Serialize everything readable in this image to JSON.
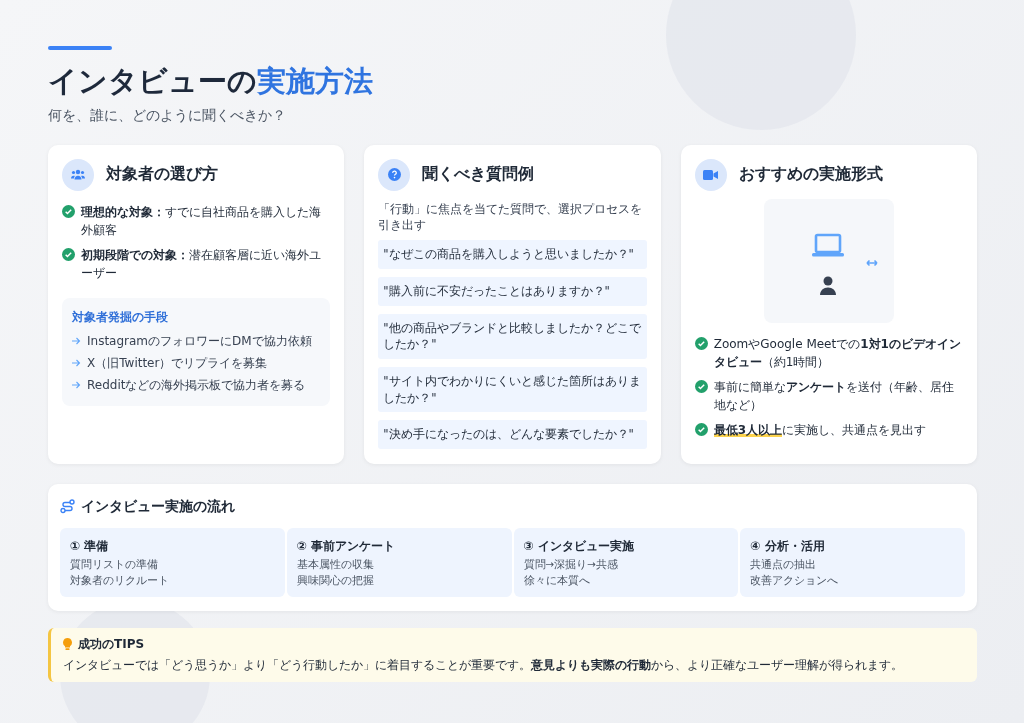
{
  "header": {
    "title": "インタビューの",
    "title_accent": "実施方法",
    "subtitle": "何を、誰に、どのように聞くべきか？"
  },
  "cards": [
    {
      "kind": "targets",
      "title": "対象者の選び方",
      "items": [
        {
          "text": "**理想的な対象：**すでに自社商品を購入した海外顧客",
          "marked": false
        },
        {
          "text": "**初期段階での対象：**潜在顧客層に近い海外ユーザー",
          "marked": false
        }
      ],
      "sub_box": {
        "title": "対象者発掘の手段",
        "items": [
          "InstagramのフォロワーにDMで協力依頼",
          "X（旧Twitter）でリプライを募集",
          "Redditなどの海外掲示板で協力者を募る"
        ]
      }
    },
    {
      "kind": "questions",
      "title": "聞くべき質問例",
      "note": "「行動」に焦点を当てた質問で、選択プロセスを引き出す",
      "questions": [
        "\"なぜこの商品を購入しようと思いましたか？\"",
        "\"購入前に不安だったことはありますか？\"",
        "\"他の商品やブランドと比較しましたか？どこでしたか？\"",
        "\"サイト内でわかりにくいと感じた箇所はありましたか？\"",
        "\"決め手になったのは、どんな要素でしたか？\""
      ]
    },
    {
      "kind": "format",
      "title": "おすすめの実施形式",
      "items": [
        {
          "text": "ZoomやGoogle Meetでの**1対1のビデオインタビュー**（約1時間）",
          "marked": false
        },
        {
          "text": "事前に簡単な**アンケート**を送付（年齢、居住地など）",
          "marked": false
        },
        {
          "text": "**最低3人以上**に実施し、共通点を見出す",
          "marked": true
        }
      ]
    }
  ],
  "flow": {
    "title": "インタビュー実施の流れ",
    "steps": [
      {
        "title": "① 準備",
        "lines": [
          "質問リストの準備",
          "対象者のリクルート"
        ]
      },
      {
        "title": "② 事前アンケート",
        "lines": [
          "基本属性の収集",
          "興味関心の把握"
        ]
      },
      {
        "title": "③ インタビュー実施",
        "lines": [
          "質問→深掘り→共感",
          "徐々に本質へ"
        ]
      },
      {
        "title": "④ 分析・活用",
        "lines": [
          "共通点の抽出",
          "改善アクションへ"
        ]
      }
    ]
  },
  "tips": {
    "title": "成功のTIPS",
    "text": "インタビューでは「どう思うか」より「どう行動したか」に着目することが重要です。**意見よりも実際の行動**から、より正確なユーザー理解が得られます。"
  }
}
